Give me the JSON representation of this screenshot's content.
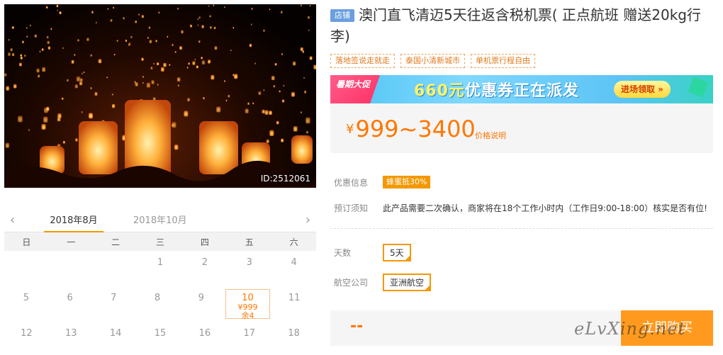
{
  "photo": {
    "id_label": "ID:2512061"
  },
  "calendar": {
    "prev_icon": "chevron-left-icon",
    "next_icon": "chevron-right-icon",
    "tabs": [
      "2018年8月",
      "2018年10月"
    ],
    "weekdays": [
      "日",
      "一",
      "二",
      "三",
      "四",
      "五",
      "六"
    ],
    "rows": [
      [
        {
          "d": ""
        },
        {
          "d": ""
        },
        {
          "d": ""
        },
        {
          "d": "1"
        },
        {
          "d": "2"
        },
        {
          "d": "3"
        },
        {
          "d": "4"
        }
      ],
      [
        {
          "d": "5"
        },
        {
          "d": "6"
        },
        {
          "d": "7"
        },
        {
          "d": "8"
        },
        {
          "d": "9"
        },
        {
          "d": "10",
          "price": "¥999",
          "stock": "余4",
          "selected": true
        },
        {
          "d": "11"
        }
      ],
      [
        {
          "d": "12"
        },
        {
          "d": "13"
        },
        {
          "d": "14"
        },
        {
          "d": "15"
        },
        {
          "d": "16"
        },
        {
          "d": "17"
        },
        {
          "d": "18"
        }
      ]
    ]
  },
  "product": {
    "shop_badge": "店铺",
    "title": "澳门直飞清迈5天往返含税机票( 正点航班 赠送20kg行李)",
    "tags": [
      "落地签说走就走",
      "泰国小清新城市",
      "单机票行程自由"
    ]
  },
  "banner": {
    "promo_label": "暑期大促",
    "amount": "660元",
    "text": "优惠券正在派发",
    "cta": "进场领取 »"
  },
  "price": {
    "currency": "¥",
    "range": "999~3400",
    "note": "价格说明"
  },
  "info": {
    "discount_label": "优惠信息",
    "discount_badge": "蜂蜜抵30%",
    "booking_label": "预订须知",
    "booking_text": "此产品需要二次确认，商家将在18个工作小时内（工作日9:00-18:00）核实是否有位!"
  },
  "options": {
    "days_label": "天数",
    "days_value": "5天",
    "airline_label": "航空公司",
    "airline_value": "亚洲航空"
  },
  "buy": {
    "total": "--",
    "button": "立即购买"
  },
  "watermark": "eLvXing.net",
  "colors": {
    "accent": "#f39800",
    "price": "#ff7700",
    "badge_blue": "#6a9fe0"
  }
}
